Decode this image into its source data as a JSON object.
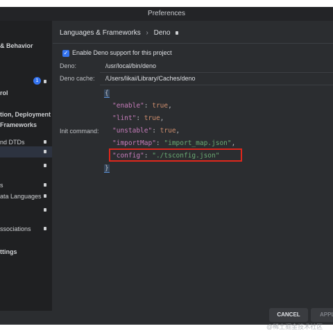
{
  "window": {
    "title": "Preferences"
  },
  "sidebar": {
    "items": [
      {
        "label": "& Behavior",
        "bold": true
      },
      {
        "label": "1",
        "type": "badge"
      },
      {
        "label": "rol",
        "bold": true
      },
      {
        "label": "tion, Deployment",
        "bold": true
      },
      {
        "label": "Frameworks",
        "bold": true
      },
      {
        "label": "nd DTDs"
      },
      {
        "label": "",
        "selected": true
      },
      {
        "label": ""
      },
      {
        "label": "s"
      },
      {
        "label": "ata Languages"
      },
      {
        "label": ""
      },
      {
        "label": "ssociations"
      },
      {
        "label": "ttings",
        "bold": true
      }
    ]
  },
  "breadcrumb": {
    "parent": "Languages & Frameworks",
    "separator": "›",
    "current": "Deno"
  },
  "settings": {
    "enable_label": "Enable Deno support for this project",
    "deno_label": "Deno:",
    "deno_value": "/usr/local/bin/deno",
    "cache_label": "Deno cache:",
    "cache_value": "/Users/likai/Library/Caches/deno",
    "init_label": "Init command:"
  },
  "code": {
    "open_brace": "{",
    "close_brace": "}",
    "lines": [
      {
        "key": "\"enable\"",
        "sep": ": ",
        "value": "true",
        "value_type": "kw",
        "end": ","
      },
      {
        "key": "\"lint\"",
        "sep": ": ",
        "value": "true",
        "value_type": "kw",
        "end": ","
      },
      {
        "key": "\"unstable\"",
        "sep": ": ",
        "value": "true",
        "value_type": "kw",
        "end": ","
      },
      {
        "key": "\"importMap\"",
        "sep": ": ",
        "value": "\"import_map.json\"",
        "value_type": "str",
        "end": ","
      },
      {
        "key": "\"config\"",
        "sep": ": ",
        "value": "\"./tsconfig.json\"",
        "value_type": "str",
        "end": ""
      }
    ]
  },
  "buttons": {
    "cancel": "CANCEL",
    "apply": "APPLY"
  },
  "watermark": "@稀土掘金技术社区",
  "colors": {
    "window_bg": "#2b2d30",
    "sidebar_bg": "#1f2022",
    "accent": "#3574f0",
    "highlight_border": "#e0271b",
    "json_key": "#c77dbb",
    "json_keyword": "#cf8e6d",
    "json_string": "#6aab73"
  }
}
